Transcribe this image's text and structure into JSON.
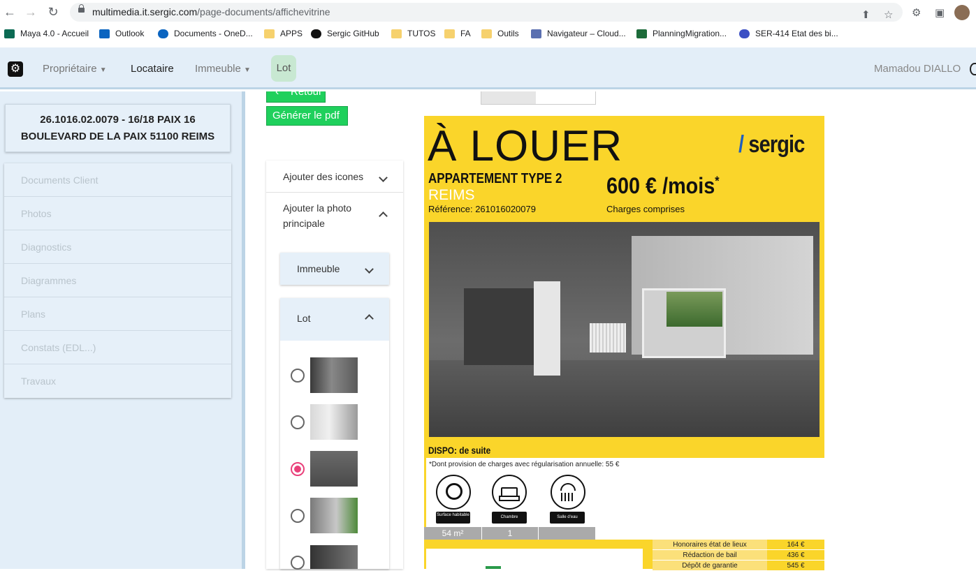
{
  "browser": {
    "url_host": "multimedia.it.sergic.com",
    "url_path": "/page-documents/affichevitrine",
    "bookmarks": [
      {
        "label": "Maya 4.0 - Accueil",
        "icon": "sharepoint-icon",
        "color": "#0b6a53"
      },
      {
        "label": "Outlook",
        "icon": "outlook-icon",
        "color": "#0a64c0"
      },
      {
        "label": "Documents - OneD...",
        "icon": "onedrive-icon",
        "color": "#0a64c0"
      },
      {
        "label": "APPS",
        "icon": "folder-icon",
        "color": "#f6d16d"
      },
      {
        "label": "Sergic GitHub",
        "icon": "github-icon",
        "color": "#111111"
      },
      {
        "label": "TUTOS",
        "icon": "folder-icon",
        "color": "#f6d16d"
      },
      {
        "label": "FA",
        "icon": "folder-icon",
        "color": "#f6d16d"
      },
      {
        "label": "Outils",
        "icon": "folder-icon",
        "color": "#f6d16d"
      },
      {
        "label": "Navigateur – Cloud...",
        "icon": "cloud-navigator-icon",
        "color": "#5a6fb0"
      },
      {
        "label": "PlanningMigration...",
        "icon": "excel-icon",
        "color": "#1d6b3a"
      },
      {
        "label": "SER-414 Etat des bi...",
        "icon": "jira-icon",
        "color": "#3b4fc4"
      }
    ]
  },
  "nav": {
    "proprietaire": "Propriétaire",
    "locataire": "Locataire",
    "immeuble": "Immeuble",
    "lot": "Lot",
    "user": "Mamadou DIALLO"
  },
  "left": {
    "card_line1": "26.1016.02.0079 - 16/18 PAIX 16",
    "card_line2": "BOULEVARD DE LA PAIX 51100 REIMS",
    "items": [
      "Documents Client",
      "Photos",
      "Diagnostics",
      "Diagrammes",
      "Plans",
      "Constats (EDL...)",
      "Travaux"
    ]
  },
  "middle": {
    "retour": "Retour",
    "generer": "Générer le pdf",
    "ajouter_icones": "Ajouter des icones",
    "ajouter_photo_1": "Ajouter la photo",
    "ajouter_photo_2": "principale",
    "immeuble": "Immeuble",
    "lot": "Lot",
    "selected_photo_index": 2
  },
  "flyer": {
    "headline": "À LOUER",
    "logo_slash": "/",
    "logo_text": "sergic",
    "type": "APPARTEMENT TYPE 2",
    "city": "REIMS",
    "reference": "Référence: 261016020079",
    "price": "600 € /mois",
    "price_star": "*",
    "charges": "Charges comprises",
    "dispo": "DISPO: de suite",
    "provision": "*Dont provision de charges avec régularisation annuelle: 55 €",
    "icons": [
      {
        "label": "Surface habitable",
        "icon": "surface-tape-icon"
      },
      {
        "label": "Chambre",
        "icon": "bed-icon"
      },
      {
        "label": "Salle d'eau",
        "icon": "shower-icon"
      }
    ],
    "surface": "54 m²",
    "chambres": "1",
    "fees": [
      {
        "label": "Honoraires état de lieux",
        "value": "164 €"
      },
      {
        "label": "Rédaction de bail",
        "value": "436 €"
      },
      {
        "label": "Dépôt de garantie",
        "value": "545 €"
      }
    ]
  }
}
